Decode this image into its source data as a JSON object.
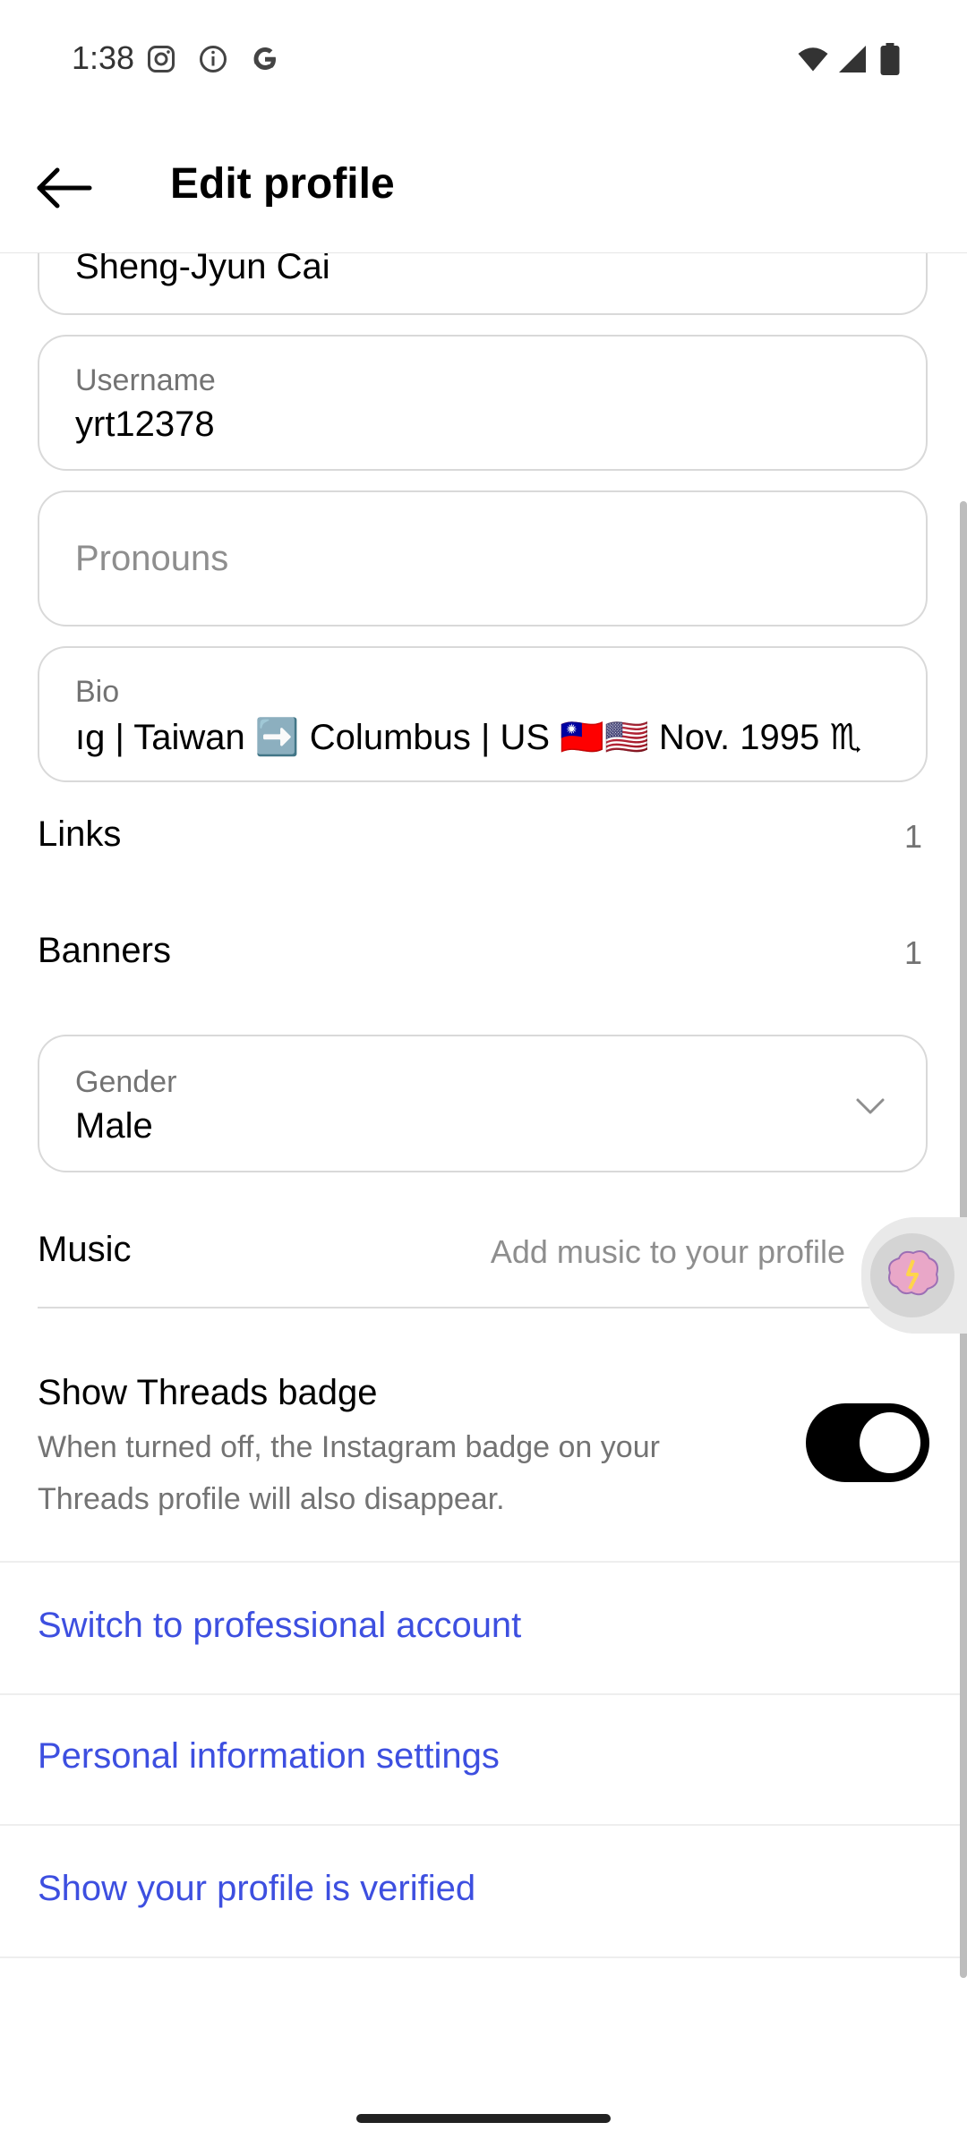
{
  "status_bar": {
    "time": "1:38"
  },
  "header": {
    "title": "Edit profile"
  },
  "fields": {
    "name_value": "Sheng-Jyun Cai",
    "username_label": "Username",
    "username_value": "yrt12378",
    "pronouns_placeholder": "Pronouns",
    "bio_label": "Bio",
    "bio_value": "ıg | Taiwan ➡️ Columbus | US 🇹🇼🇺🇸 Nov. 1995 ♏",
    "gender_label": "Gender",
    "gender_value": "Male"
  },
  "rows": {
    "links_label": "Links",
    "links_count": "1",
    "banners_label": "Banners",
    "banners_count": "1"
  },
  "music": {
    "label": "Music",
    "hint": "Add music to your profile"
  },
  "threads_badge": {
    "title": "Show Threads badge",
    "description": "When turned off, the Instagram badge on your Threads profile will also disappear.",
    "enabled": true
  },
  "links": {
    "switch_professional": "Switch to professional account",
    "personal_info": "Personal information settings",
    "verified": "Show your profile is verified"
  },
  "colors": {
    "link_blue": "#3d4fe0",
    "toggle_on": "#000000",
    "muted_text": "#737373",
    "border": "#d9d9d9"
  },
  "icons": {
    "back": "arrow-left-icon",
    "dropdown": "chevron-down-icon",
    "music_chevron": "chevron-right-icon",
    "floating_bubble": "brain-bubble-icon"
  }
}
